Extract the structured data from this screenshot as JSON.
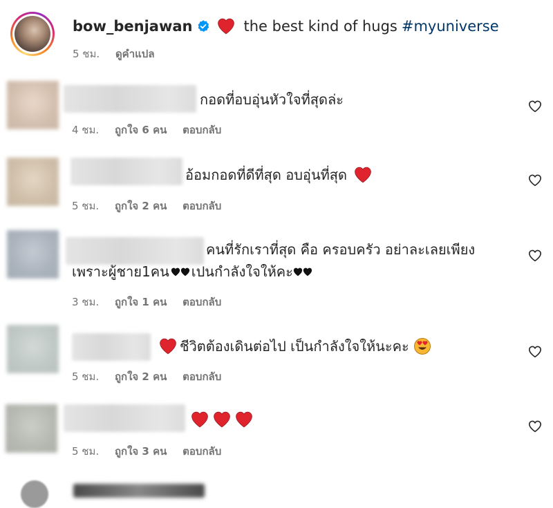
{
  "post": {
    "username": "bow_benjawan",
    "caption": "the best kind of hugs",
    "hashtag": "#myuniverse",
    "time": "5 ชม.",
    "translate_label": "ดูคำแปล"
  },
  "comments": [
    {
      "text": "กอดที่อบอุ่นหัวใจที่สุดล่ะ",
      "time": "4 ชม.",
      "likes": "ถูกใจ 6 คน",
      "reply": "ตอบกลับ",
      "avatar_color": "#d8c7b8"
    },
    {
      "text": "อ้อมกอดที่ดีที่สุด อบอุ่นที่สุด",
      "time": "5 ชม.",
      "likes": "ถูกใจ 2 คน",
      "reply": "ตอบกลับ",
      "avatar_color": "#d6c6b2"
    },
    {
      "text_line1": "คนที่รักเราที่สุด คือ ครอบครัว อย่าละเลยเพียง",
      "text_line2": "เพราะผู้ชาย1คน",
      "text_mid": "เปนกำลังใจให้คะ",
      "time": "3 ชม.",
      "likes": "ถูกใจ 1 คน",
      "reply": "ตอบกลับ",
      "avatar_color": "#b5bcc4"
    },
    {
      "text": "ชีวิตต้องเดินต่อไป เป็นกำลังใจให้นะคะ",
      "time": "5 ชม.",
      "likes": "ถูกใจ 2 คน",
      "reply": "ตอบกลับ",
      "avatar_color": "#c3cbc8"
    },
    {
      "text": "",
      "time": "5 ชม.",
      "likes": "ถูกใจ 3 คน",
      "reply": "ตอบกลับ",
      "avatar_color": "#bbbdb8"
    }
  ],
  "colors": {
    "heart": "#ed4956",
    "hashtag": "#00376b",
    "verified": "#0095f6",
    "meta": "#737373"
  },
  "icons": {
    "verified": "verified-badge-icon",
    "heart_emoji": "red-heart-emoji",
    "black_heart": "black-heart-emoji",
    "heart_eyes": "heart-eyes-emoji",
    "like": "heart-outline-icon"
  }
}
